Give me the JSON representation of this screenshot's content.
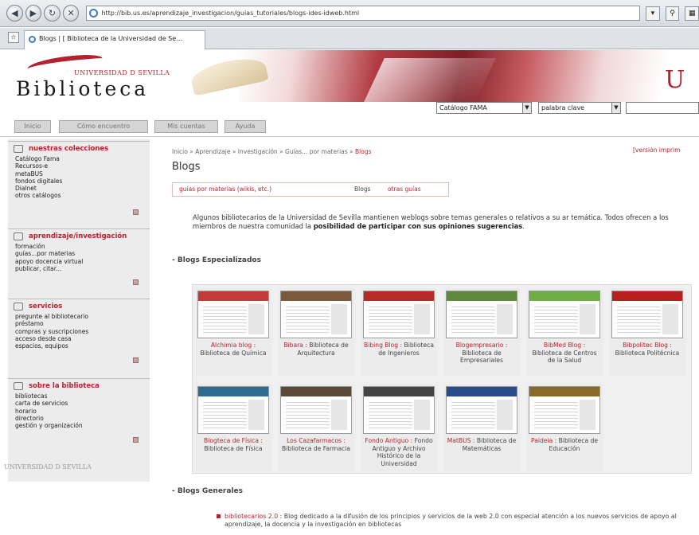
{
  "browser": {
    "url": "http://bib.us.es/aprendizaje_investigacion/guias_tutoriales/blogs-ides-idweb.html",
    "tab_title": "Blogs | [ Biblioteca de la Universidad de Se..."
  },
  "header": {
    "univ_line": "UNIVERSIDAD D SEVILLA",
    "logo_text": "Biblioteca",
    "us_mark": "U"
  },
  "search": {
    "catalog_select": "Catálogo FAMA",
    "keyword_select": "palabra clave"
  },
  "topnav": [
    "Inicio",
    "Cómo encuentro",
    "Mis cuentas",
    "Ayuda"
  ],
  "sidebar": {
    "sections": [
      {
        "title": "nuestras colecciones",
        "items": [
          "Catálogo Fama",
          "Recursos-e",
          "metaBUS",
          "fondos digitales",
          "Dialnet",
          "otros catálogos"
        ]
      },
      {
        "title": "aprendizaje/investigación",
        "items": [
          "formación",
          "guías...por materias",
          "apoyo docencia virtual",
          "publicar, citar..."
        ]
      },
      {
        "title": "servicios",
        "items": [
          "pregunte al bibliotecario",
          "préstamo",
          "compras y suscripciones",
          "acceso desde casa",
          "espacios, equipos"
        ]
      },
      {
        "title": "sobre la biblioteca",
        "items": [
          "bibliotecas",
          "carta de servicios",
          "horario",
          "directorio",
          "gestión y organización"
        ]
      }
    ],
    "footer": "UNIVERSIDAD D SEVILLA"
  },
  "main": {
    "breadcrumb": {
      "path": "Inicio » Aprendizaje » Investigación » Guías... por materias » ",
      "current": "Blogs"
    },
    "print_version": "[versión imprim",
    "title": "Blogs",
    "subnav": [
      "guías por materias (wikis, etc.)",
      "Blogs",
      "otras guías"
    ],
    "intro_text": "Algunos bibliotecarios de la Universidad de Sevilla mantienen weblogs sobre temas generales o relativos a su ar temática. Todos ofrecen a los miembros de nuestra comunidad la ",
    "intro_bold": "posibilidad de participar con sus opiniones sugerencias",
    "intro_end": ".",
    "section_specialized": "- Blogs Especializados",
    "section_general": "- Blogs Generales",
    "blogs": [
      {
        "title": "Alchimia blog :",
        "desc": "Biblioteca de Química",
        "head_color": "#c23a3a"
      },
      {
        "title": "Bibara :",
        "desc": "Biblioteca de Arquitectura",
        "head_color": "#7a5a3a"
      },
      {
        "title": "Bibing Blog :",
        "desc": "Biblioteca de Ingenieros",
        "head_color": "#b72a2a"
      },
      {
        "title": "Blogempresario :",
        "desc": "Biblioteca de Empresariales",
        "head_color": "#5f8a3c"
      },
      {
        "title": "BibMed Blog :",
        "desc": "Biblioteca de Centros de la Salud",
        "head_color": "#6fae45"
      },
      {
        "title": "Bibpolitec Blog :",
        "desc": "Biblioteca Politécnica",
        "head_color": "#b82020"
      },
      {
        "title": "Blogteca de Física :",
        "desc": "Biblioteca de Física",
        "head_color": "#2f6d8f"
      },
      {
        "title": "Los Cazafarmacos :",
        "desc": "Biblioteca de Farmacia",
        "head_color": "#5a4a3a"
      },
      {
        "title": "Fondo Antiguo :",
        "desc": "Fondo Antiguo y Archivo Histórico de la Universidad",
        "head_color": "#444444"
      },
      {
        "title": "MatBUS :",
        "desc": "Biblioteca de Matemáticas",
        "head_color": "#2b4c8a"
      },
      {
        "title": "Paideia :",
        "desc": "Biblioteca de Educación",
        "head_color": "#8a6a2a"
      }
    ],
    "general": {
      "link": "bibliotecarios 2.0",
      "text": " : Blog dedicado a la difusión de los principios y servicios de la web 2.0 con especial atención a los nuevos servicios de apoyo al aprendizaje, la docencia y la investigación en bibliotecas"
    }
  }
}
